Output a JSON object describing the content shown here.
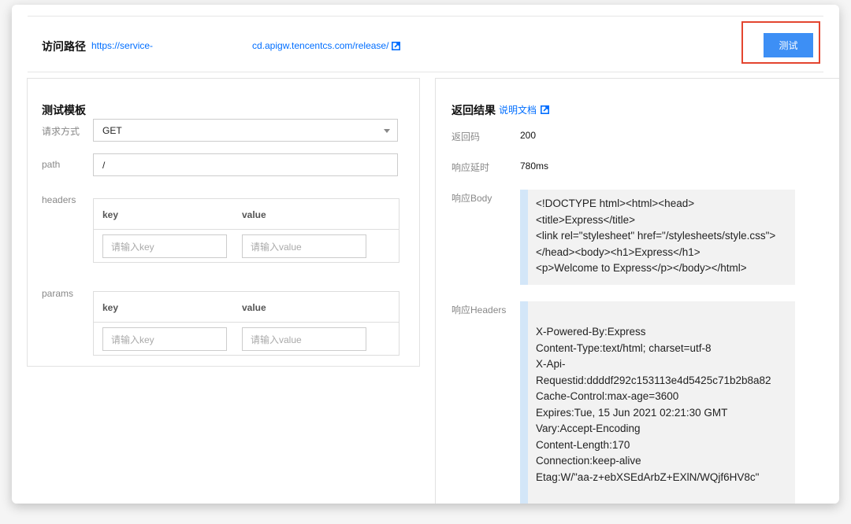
{
  "url": {
    "label": "访问路径",
    "part_a": "https://service-",
    "part_b": "cd.apigw.tencentcs.com/release/"
  },
  "test_button": "测试",
  "template": {
    "title": "测试模板",
    "method_label": "请求方式",
    "method_value": "GET",
    "path_label": "path",
    "path_value": "/",
    "headers_label": "headers",
    "params_label": "params",
    "key_col": "key",
    "value_col": "value",
    "key_placeholder": "请输入key",
    "value_placeholder": "请输入value"
  },
  "result": {
    "title": "返回结果",
    "doc_link": "说明文档",
    "code_label": "返回码",
    "code_value": "200",
    "latency_label": "响应延时",
    "latency_value": "780ms",
    "body_label": "响应Body",
    "body_lines": [
      "<!DOCTYPE html><html><head>",
      "<title>Express</title>",
      "<link rel=\"stylesheet\" href=\"/stylesheets/style.css\">",
      "</head><body><h1>Express</h1>",
      "<p>Welcome to Express</p></body></html>"
    ],
    "headers_label": "响应Headers",
    "header_lines": [
      "X-Powered-By:Express",
      "Content-Type:text/html; charset=utf-8",
      "X-Api-",
      "Requestid:ddddf292c153113e4d5425c71b2b8a82",
      "Cache-Control:max-age=3600",
      "Expires:Tue, 15 Jun 2021 02:21:30 GMT",
      "Vary:Accept-Encoding",
      "Content-Length:170",
      "Connection:keep-alive",
      "Etag:W/\"aa-z+ebXSEdArbZ+EXlN/WQjf6HV8c\""
    ]
  },
  "colors": {
    "link": "#006eff",
    "button": "#3d8ff5",
    "highlight_border": "#e3452f",
    "code_accent": "#d3e6f8"
  }
}
